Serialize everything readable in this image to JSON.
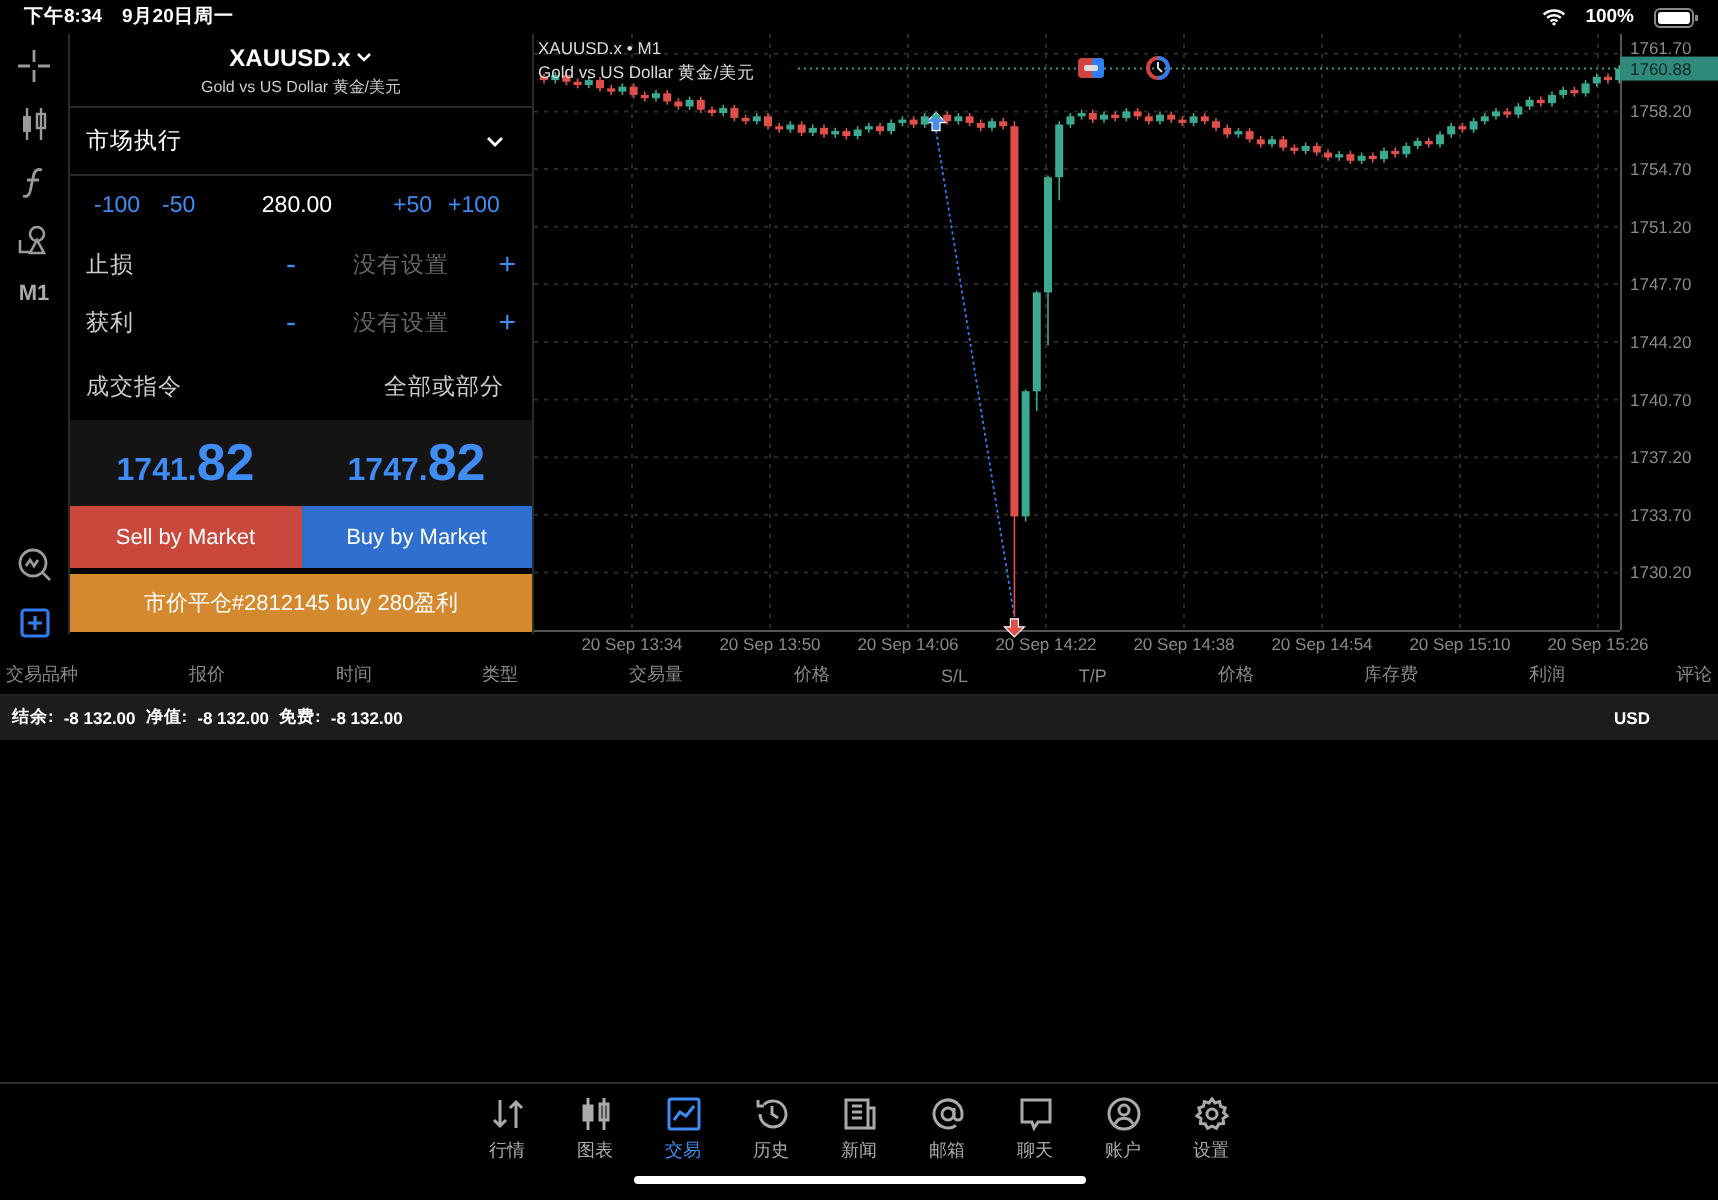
{
  "status_bar": {
    "time": "下午8:34",
    "date": "9月20日周一",
    "battery": "100%"
  },
  "toolbar": {
    "timeframe": "M1"
  },
  "order_panel": {
    "symbol": "XAUUSD.x",
    "description": "Gold vs US Dollar 黄金/美元",
    "execution": "市场执行",
    "volume": {
      "steps_down": [
        "-100",
        "-50"
      ],
      "value": "280.00",
      "steps_up": [
        "+50",
        "+100"
      ]
    },
    "stop_loss": {
      "label": "止损",
      "minus": "-",
      "placeholder": "没有设置",
      "plus": "+"
    },
    "take_profit": {
      "label": "获利",
      "minus": "-",
      "placeholder": "没有设置",
      "plus": "+"
    },
    "fill_policy": {
      "label": "成交指令",
      "value": "全部或部分"
    },
    "bid": {
      "main": "1741.",
      "big": "82"
    },
    "ask": {
      "main": "1747.",
      "big": "82"
    },
    "sell_button": "Sell by Market",
    "buy_button": "Buy by Market",
    "close_button": "市价平仓#2812145 buy 280盈利"
  },
  "chart": {
    "symbol": "XAUUSD.x • M1",
    "description": "Gold vs US Dollar 黄金/美元",
    "current_price": "1760.88",
    "time_labels": [
      "20 Sep 13:34",
      "20 Sep 13:50",
      "20 Sep 14:06",
      "20 Sep 14:22",
      "20 Sep 14:38",
      "20 Sep 14:54",
      "20 Sep 15:10",
      "20 Sep 15:26"
    ],
    "chart_data": {
      "type": "candlestick",
      "grid": true,
      "ylim": [
        1726.7,
        1762.9
      ],
      "yticks": [
        {
          "value": 1761.7,
          "label": "1761.70"
        },
        {
          "value": 1758.2,
          "label": "1758.20"
        },
        {
          "value": 1754.7,
          "label": "1754.70"
        },
        {
          "value": 1751.2,
          "label": "1751.20"
        },
        {
          "value": 1747.7,
          "label": "1747.70"
        },
        {
          "value": 1744.2,
          "label": "1744.20"
        },
        {
          "value": 1740.7,
          "label": "1740.70"
        },
        {
          "value": 1737.2,
          "label": "1737.20"
        },
        {
          "value": 1733.7,
          "label": "1733.70"
        },
        {
          "value": 1730.2,
          "label": "1730.20"
        }
      ],
      "ohlc": [
        [
          1760.3,
          1760.5,
          1759.9,
          1760.1
        ],
        [
          1760.1,
          1760.6,
          1759.9,
          1760.4
        ],
        [
          1760.4,
          1760.6,
          1759.8,
          1760.0
        ],
        [
          1760.0,
          1760.2,
          1759.6,
          1759.8
        ],
        [
          1759.8,
          1760.3,
          1759.6,
          1760.1
        ],
        [
          1760.1,
          1760.3,
          1759.4,
          1759.6
        ],
        [
          1759.6,
          1759.8,
          1759.2,
          1759.4
        ],
        [
          1759.4,
          1759.9,
          1759.2,
          1759.7
        ],
        [
          1759.7,
          1759.9,
          1759.0,
          1759.2
        ],
        [
          1759.2,
          1759.4,
          1758.8,
          1759.0
        ],
        [
          1759.0,
          1759.5,
          1758.8,
          1759.3
        ],
        [
          1759.3,
          1759.5,
          1758.6,
          1758.8
        ],
        [
          1758.8,
          1759.0,
          1758.3,
          1758.5
        ],
        [
          1758.5,
          1759.1,
          1758.3,
          1758.9
        ],
        [
          1758.9,
          1759.1,
          1758.1,
          1758.3
        ],
        [
          1758.3,
          1758.5,
          1757.9,
          1758.1
        ],
        [
          1758.1,
          1758.6,
          1757.9,
          1758.4
        ],
        [
          1758.4,
          1758.6,
          1757.6,
          1757.8
        ],
        [
          1757.8,
          1758.0,
          1757.4,
          1757.6
        ],
        [
          1757.6,
          1758.1,
          1757.4,
          1757.9
        ],
        [
          1757.9,
          1758.1,
          1757.1,
          1757.3
        ],
        [
          1757.3,
          1757.5,
          1756.9,
          1757.1
        ],
        [
          1757.1,
          1757.6,
          1756.9,
          1757.4
        ],
        [
          1757.4,
          1757.6,
          1756.7,
          1756.9
        ],
        [
          1756.9,
          1757.4,
          1756.7,
          1757.2
        ],
        [
          1757.2,
          1757.4,
          1756.6,
          1756.8
        ],
        [
          1756.8,
          1757.2,
          1756.6,
          1757.0
        ],
        [
          1757.0,
          1757.2,
          1756.5,
          1756.7
        ],
        [
          1756.7,
          1757.3,
          1756.5,
          1757.1
        ],
        [
          1757.1,
          1757.5,
          1756.9,
          1757.3
        ],
        [
          1757.3,
          1757.5,
          1756.8,
          1757.0
        ],
        [
          1757.0,
          1757.7,
          1756.8,
          1757.5
        ],
        [
          1757.5,
          1757.9,
          1757.3,
          1757.7
        ],
        [
          1757.7,
          1757.9,
          1757.2,
          1757.4
        ],
        [
          1757.4,
          1758.1,
          1757.2,
          1757.9
        ],
        [
          1757.9,
          1758.2,
          1757.7,
          1758.0
        ],
        [
          1758.0,
          1758.2,
          1757.4,
          1757.6
        ],
        [
          1757.6,
          1758.1,
          1757.4,
          1757.9
        ],
        [
          1757.9,
          1758.1,
          1757.3,
          1757.5
        ],
        [
          1757.5,
          1757.7,
          1757.0,
          1757.2
        ],
        [
          1757.2,
          1757.8,
          1757.0,
          1757.6
        ],
        [
          1757.6,
          1757.8,
          1757.1,
          1757.3
        ],
        [
          1757.3,
          1757.6,
          1727.5,
          1733.6
        ],
        [
          1733.6,
          1741.3,
          1733.3,
          1741.2
        ],
        [
          1741.2,
          1747.3,
          1740.0,
          1747.2
        ],
        [
          1747.2,
          1754.3,
          1744.0,
          1754.2
        ],
        [
          1754.2,
          1757.6,
          1752.8,
          1757.4
        ],
        [
          1757.4,
          1758.1,
          1757.2,
          1757.9
        ],
        [
          1757.9,
          1758.3,
          1757.7,
          1758.1
        ],
        [
          1758.1,
          1758.3,
          1757.5,
          1757.7
        ],
        [
          1757.7,
          1758.2,
          1757.5,
          1758.0
        ],
        [
          1758.0,
          1758.2,
          1757.6,
          1757.8
        ],
        [
          1757.8,
          1758.4,
          1757.6,
          1758.2
        ],
        [
          1758.2,
          1758.4,
          1757.7,
          1757.9
        ],
        [
          1757.9,
          1758.1,
          1757.4,
          1757.6
        ],
        [
          1757.6,
          1758.2,
          1757.4,
          1758.0
        ],
        [
          1758.0,
          1758.2,
          1757.5,
          1757.7
        ],
        [
          1757.7,
          1757.9,
          1757.3,
          1757.5
        ],
        [
          1757.5,
          1758.1,
          1757.3,
          1757.9
        ],
        [
          1757.9,
          1758.1,
          1757.4,
          1757.6
        ],
        [
          1757.6,
          1757.8,
          1757.0,
          1757.2
        ],
        [
          1757.2,
          1757.4,
          1756.6,
          1756.8
        ],
        [
          1756.8,
          1757.2,
          1756.6,
          1757.0
        ],
        [
          1757.0,
          1757.2,
          1756.3,
          1756.5
        ],
        [
          1756.5,
          1756.7,
          1756.0,
          1756.2
        ],
        [
          1756.2,
          1756.7,
          1756.0,
          1756.5
        ],
        [
          1756.5,
          1756.7,
          1755.8,
          1756.0
        ],
        [
          1756.0,
          1756.2,
          1755.6,
          1755.8
        ],
        [
          1755.8,
          1756.3,
          1755.6,
          1756.1
        ],
        [
          1756.1,
          1756.3,
          1755.5,
          1755.7
        ],
        [
          1755.7,
          1755.9,
          1755.2,
          1755.4
        ],
        [
          1755.4,
          1755.8,
          1755.2,
          1755.6
        ],
        [
          1755.6,
          1755.8,
          1755.0,
          1755.2
        ],
        [
          1755.2,
          1755.7,
          1755.0,
          1755.5
        ],
        [
          1755.5,
          1755.7,
          1755.1,
          1755.3
        ],
        [
          1755.3,
          1756.0,
          1755.1,
          1755.8
        ],
        [
          1755.8,
          1756.0,
          1755.4,
          1755.6
        ],
        [
          1755.6,
          1756.3,
          1755.4,
          1756.1
        ],
        [
          1756.1,
          1756.6,
          1755.9,
          1756.4
        ],
        [
          1756.4,
          1756.6,
          1756.0,
          1756.2
        ],
        [
          1756.2,
          1757.0,
          1756.0,
          1756.8
        ],
        [
          1756.8,
          1757.5,
          1756.6,
          1757.3
        ],
        [
          1757.3,
          1757.5,
          1756.9,
          1757.1
        ],
        [
          1757.1,
          1757.8,
          1756.9,
          1757.6
        ],
        [
          1757.6,
          1758.1,
          1757.4,
          1757.9
        ],
        [
          1757.9,
          1758.4,
          1757.7,
          1758.2
        ],
        [
          1758.2,
          1758.4,
          1757.8,
          1758.0
        ],
        [
          1758.0,
          1758.7,
          1757.8,
          1758.5
        ],
        [
          1758.5,
          1759.1,
          1758.3,
          1758.9
        ],
        [
          1758.9,
          1759.1,
          1758.5,
          1758.7
        ],
        [
          1758.7,
          1759.4,
          1758.5,
          1759.2
        ],
        [
          1759.2,
          1759.7,
          1759.0,
          1759.5
        ],
        [
          1759.5,
          1759.7,
          1759.1,
          1759.3
        ],
        [
          1759.3,
          1760.1,
          1759.1,
          1759.9
        ],
        [
          1759.9,
          1760.5,
          1759.7,
          1760.3
        ],
        [
          1760.3,
          1760.5,
          1759.9,
          1760.1
        ],
        [
          1760.1,
          1761.0,
          1759.9,
          1760.8
        ]
      ]
    }
  },
  "table": {
    "columns": [
      "交易品种",
      "报价",
      "时间",
      "类型",
      "交易量",
      "价格",
      "S/L",
      "T/P",
      "价格",
      "库存费",
      "利润",
      "评论"
    ]
  },
  "account": {
    "items": [
      {
        "label": "结余:",
        "value": "-8 132.00"
      },
      {
        "label": "净值:",
        "value": "-8 132.00"
      },
      {
        "label": "免费:",
        "value": "-8 132.00"
      }
    ],
    "currency": "USD"
  },
  "tabs": [
    {
      "label": "行情",
      "selected": false
    },
    {
      "label": "图表",
      "selected": false
    },
    {
      "label": "交易",
      "selected": true
    },
    {
      "label": "历史",
      "selected": false
    },
    {
      "label": "新闻",
      "selected": false
    },
    {
      "label": "邮箱",
      "selected": false
    },
    {
      "label": "聊天",
      "selected": false
    },
    {
      "label": "账户",
      "selected": false
    },
    {
      "label": "设置",
      "selected": false
    }
  ]
}
